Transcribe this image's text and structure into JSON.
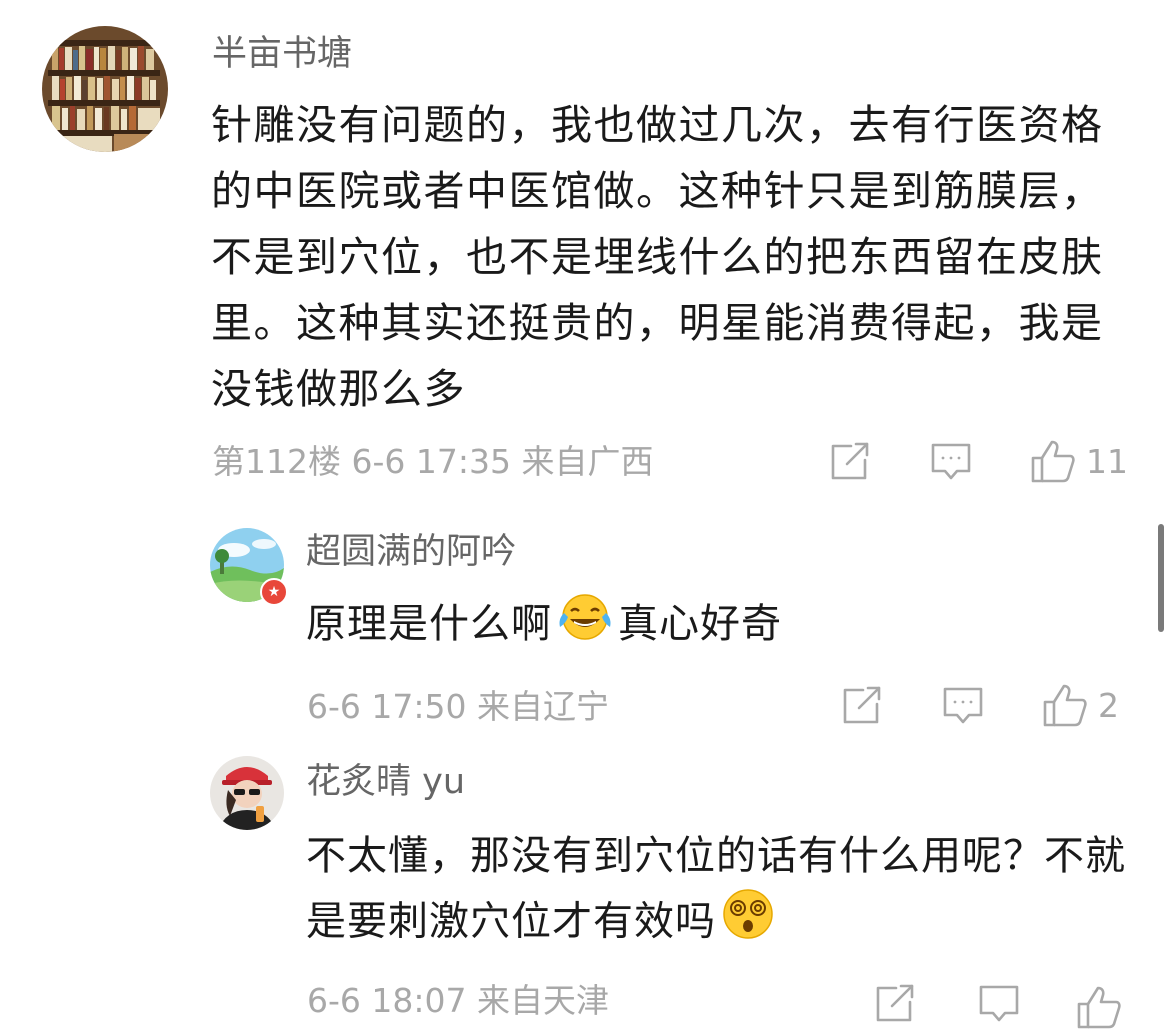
{
  "comments": [
    {
      "username": "半亩书塘",
      "text": "针雕没有问题的，我也做过几次，去有行医资格的中医院或者中医馆做。这种针只是到筋膜层，不是到穴位，也不是埋线什么的把东西留在皮肤里。这种其实还挺贵的，明星能消费得起，我是没钱做那么多",
      "meta": "第112楼 6-6 17:35 来自广西",
      "likes": "11"
    },
    {
      "username": "超圆满的阿吟",
      "text_before": "原理是什么啊",
      "text_after": "真心好奇",
      "emoji": "laughing-crying-emoji",
      "meta": "6-6 17:50 来自辽宁",
      "likes": "2"
    },
    {
      "username": "花炙晴 yu",
      "text": "不太懂，那没有到穴位的话有什么用呢？不就是要刺激穴位才有效吗",
      "emoji": "dizzy-face-emoji",
      "meta": "6-6 18:07 来自天津"
    }
  ],
  "icons": {
    "share": "share-icon",
    "reply": "comment-icon",
    "like": "thumbs-up-icon"
  },
  "colors": {
    "text": "#1a1a1a",
    "username": "#666666",
    "meta": "#a8a8a8"
  }
}
